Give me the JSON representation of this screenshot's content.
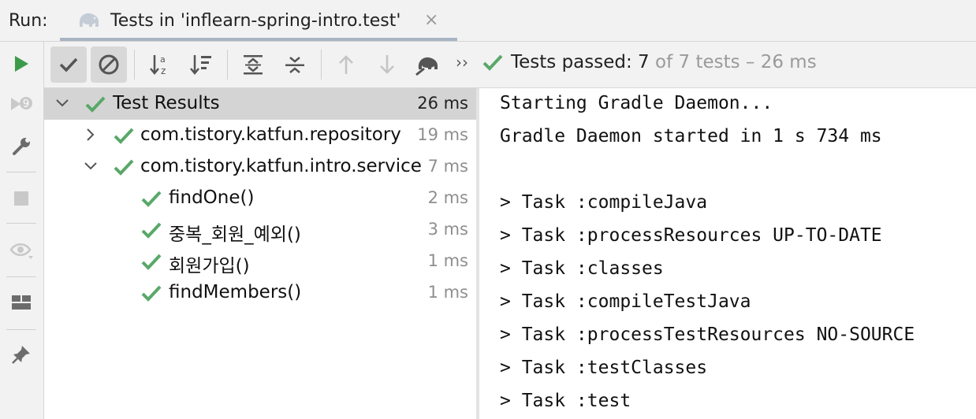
{
  "run_label": "Run:",
  "tab": {
    "title": "Tests in 'inflearn-spring-intro.test'",
    "close": "×"
  },
  "toolbar": {
    "overflow": "››",
    "status_passed": "Tests passed: 7",
    "status_total": " of 7 tests – 26 ms"
  },
  "tree": [
    {
      "name": "Test Results",
      "time": "26 ms",
      "expanded": true,
      "selected": true
    },
    {
      "name": "com.tistory.katfun.repository",
      "time": "19 ms",
      "expanded": false
    },
    {
      "name": "com.tistory.katfun.intro.service",
      "time": "7 ms",
      "expanded": true
    },
    {
      "name": "findOne()",
      "time": "2 ms"
    },
    {
      "name": "중복_회원_예외()",
      "time": "3 ms"
    },
    {
      "name": "회원가입()",
      "time": "1 ms"
    },
    {
      "name": "findMembers()",
      "time": "1 ms"
    }
  ],
  "console": [
    "Starting Gradle Daemon...",
    "Gradle Daemon started in 1 s 734 ms",
    "",
    "> Task :compileJava",
    "> Task :processResources UP-TO-DATE",
    "> Task :classes",
    "> Task :compileTestJava",
    "> Task :processTestResources NO-SOURCE",
    "> Task :testClasses",
    "> Task :test"
  ],
  "colors": {
    "success": "#59a869",
    "run": "#3d9a4a",
    "panel": "#f2f2f2",
    "selection": "#d4d4d4"
  },
  "icons": [
    "run-icon",
    "rerun-failed-icon",
    "settings-wrench-icon",
    "stop-icon",
    "eye-icon",
    "layout-icon",
    "pin-icon",
    "show-passed-icon",
    "show-ignored-icon",
    "sort-alpha-icon",
    "sort-duration-icon",
    "expand-all-icon",
    "collapse-all-icon",
    "previous-failure-icon",
    "next-failure-icon",
    "gradle-elephant-icon",
    "check-icon"
  ]
}
